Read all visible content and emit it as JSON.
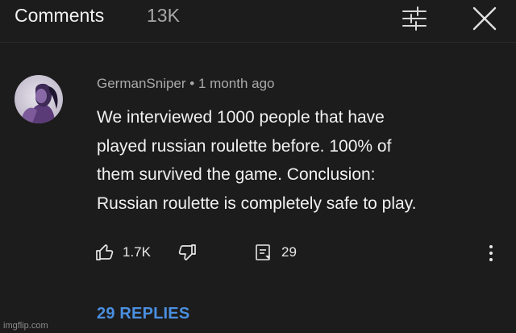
{
  "header": {
    "title": "Comments",
    "count": "13K",
    "filter_icon": "sort-filter-icon",
    "close_icon": "close-icon"
  },
  "comment": {
    "avatar_icon": "avatar",
    "author": "GermanSniper",
    "separator": " • ",
    "time": "1 month ago",
    "body_lines": [
      "We interviewed 1000 people that have",
      "played russian roulette before. 100% of",
      "them survived the game. Conclusion:",
      "Russian roulette is completely safe to play."
    ],
    "likes": "1.7K",
    "reply_count": "29",
    "replies_label": "29 REPLIES"
  },
  "watermark": "imgflip.com",
  "colors": {
    "background": "#1c1c1c",
    "accent_link": "#4a8fe0",
    "text_primary": "#f1f1f1",
    "text_secondary": "#aaaaaa"
  }
}
